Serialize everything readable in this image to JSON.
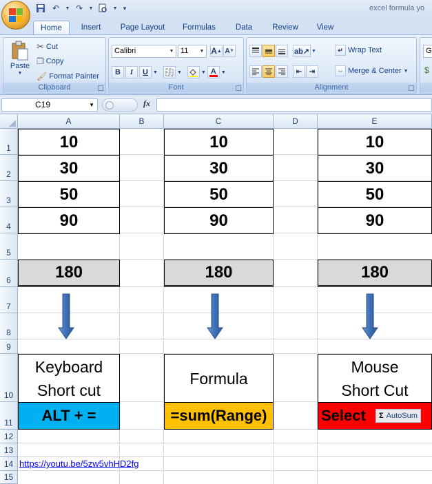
{
  "window": {
    "title": "excel formula yo"
  },
  "tabs": [
    "Home",
    "Insert",
    "Page Layout",
    "Formulas",
    "Data",
    "Review",
    "View"
  ],
  "clipboard": {
    "group_label": "Clipboard",
    "paste": "Paste",
    "cut": "Cut",
    "copy": "Copy",
    "format_painter": "Format Painter"
  },
  "font": {
    "group_label": "Font",
    "name": "Calibri",
    "size": "11",
    "bold": "B",
    "italic": "I",
    "underline": "U",
    "grow": "A",
    "shrink": "A"
  },
  "alignment": {
    "group_label": "Alignment",
    "wrap_text": "Wrap Text",
    "merge_center": "Merge & Center"
  },
  "number": {
    "format_partial": "Ge"
  },
  "formula_bar": {
    "name_box": "C19",
    "fx": "fx",
    "value": ""
  },
  "columns": [
    "A",
    "B",
    "C",
    "D",
    "E"
  ],
  "rows": [
    "1",
    "2",
    "3",
    "4",
    "5",
    "6",
    "7",
    "8",
    "9",
    "10",
    "11",
    "12",
    "13",
    "14",
    "15"
  ],
  "sheet": {
    "values": [
      "10",
      "30",
      "50",
      "90"
    ],
    "total": "180",
    "keyboard_label": [
      "Keyboard",
      "Short cut"
    ],
    "formula_label": "Formula",
    "mouse_label": [
      "Mouse",
      "Short Cut"
    ],
    "keyboard_method": "ALT + =",
    "formula_method": "=sum(Range)",
    "mouse_method": "Select",
    "autosum_label": "AutoSum",
    "autosum_symbol": "Σ",
    "link": "https://youtu.be/5zw5vhHD2fg"
  },
  "colors": {
    "keyboard_bg": "#00b0f0",
    "formula_bg": "#ffc000",
    "mouse_bg": "#ff0000",
    "arrow": "#4f81bd",
    "total_bg": "#d9d9d9"
  }
}
